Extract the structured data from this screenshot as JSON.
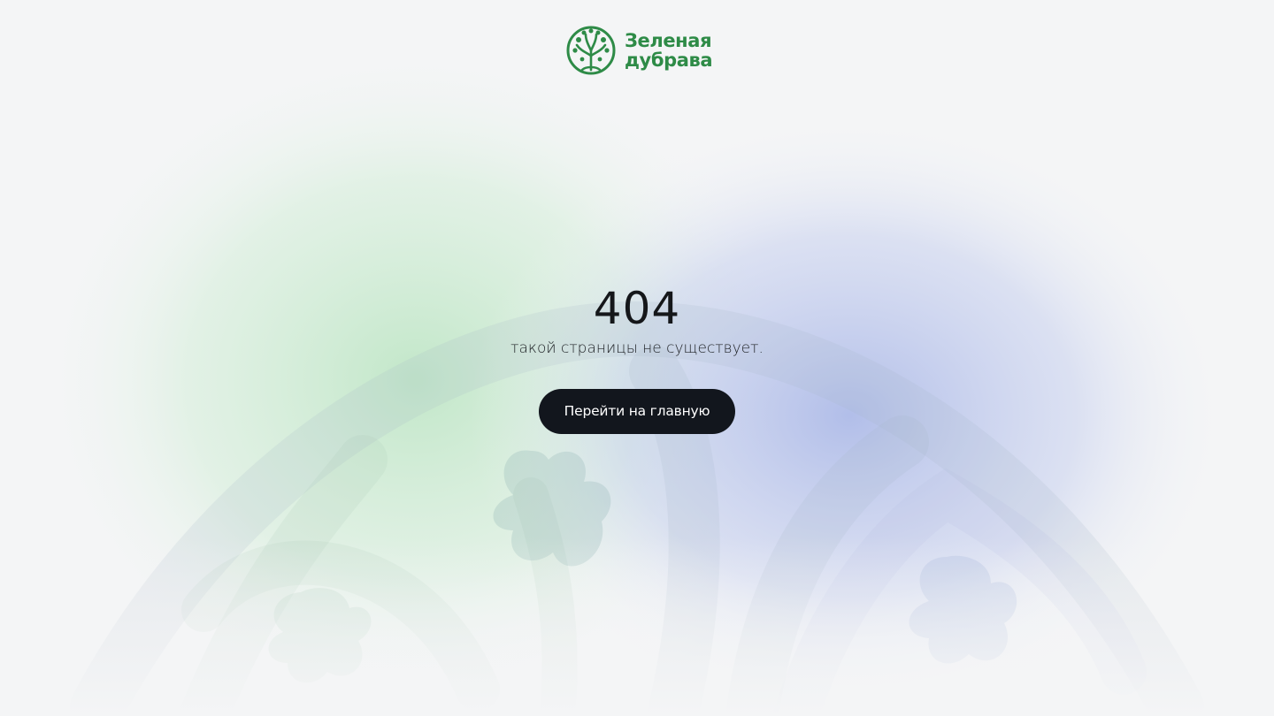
{
  "header": {
    "logo_line1": "Зеленая",
    "logo_line2": "дубрава",
    "logo_icon": "oak-tree-icon",
    "brand_color": "#2e8b47"
  },
  "error": {
    "code": "404",
    "message": "такой страницы не существует.",
    "home_button_label": "Перейти на главную"
  },
  "colors": {
    "background": "#f4f5f6",
    "text": "#15171a",
    "button_bg": "#12161d",
    "button_text": "#ffffff",
    "glow_green": "#bfe6c6",
    "glow_blue": "#a8b6e6"
  }
}
